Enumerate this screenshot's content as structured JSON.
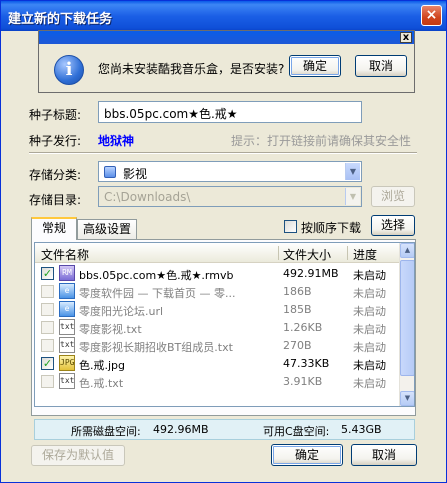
{
  "window": {
    "title": "建立新的下载任务",
    "close_glyph": "×"
  },
  "prompt": {
    "message": "您尚未安装酷我音乐盒，是否安装?",
    "ok_label": "确定",
    "cancel_label": "取消",
    "close_glyph": "x",
    "icon_glyph": "i"
  },
  "form": {
    "torrent_title_label": "种子标题:",
    "torrent_title_value": "bbs.05pc.com★色.戒★",
    "torrent_publisher_label": "种子发行:",
    "torrent_publisher_value": "地狱神",
    "hint": "提示：打开链接前请确保其安全性",
    "category_label": "存储分类:",
    "category_value": "影视",
    "directory_label": "存储目录:",
    "directory_value": "C:\\Downloads\\",
    "browse_label": "浏览"
  },
  "tabs": [
    {
      "label": "常规"
    },
    {
      "label": "高级设置"
    }
  ],
  "sequential_label": "按顺序下载",
  "select_label": "选择",
  "file_list": {
    "columns": [
      "文件名称",
      "文件大小",
      "进度"
    ],
    "rows": [
      {
        "name": "bbs.05pc.com★色.戒★.rmvb",
        "size": "492.91MB",
        "status": "未启动",
        "checked": true,
        "icon": "rmvb"
      },
      {
        "name": "零度软件园 — 下载首页 — 零...",
        "size": "186B",
        "status": "未启动",
        "checked": false,
        "icon": "url"
      },
      {
        "name": "零度阳光论坛.url",
        "size": "185B",
        "status": "未启动",
        "checked": false,
        "icon": "url"
      },
      {
        "name": "零度影视.txt",
        "size": "1.26KB",
        "status": "未启动",
        "checked": false,
        "icon": "txt"
      },
      {
        "name": "零度影视长期招收BT组成员.txt",
        "size": "270B",
        "status": "未启动",
        "checked": false,
        "icon": "txt"
      },
      {
        "name": "色.戒.jpg",
        "size": "47.33KB",
        "status": "未启动",
        "checked": true,
        "icon": "jpg"
      },
      {
        "name": "色.戒.txt",
        "size": "3.91KB",
        "status": "未启动",
        "checked": false,
        "icon": "txt"
      }
    ]
  },
  "disk": {
    "required_label": "所需磁盘空间:",
    "required_value": "492.96MB",
    "available_label": "可用C盘空间:",
    "available_value": "5.43GB"
  },
  "footer": {
    "save_default_label": "保存为默认值",
    "ok_label": "确定",
    "cancel_label": "取消"
  }
}
